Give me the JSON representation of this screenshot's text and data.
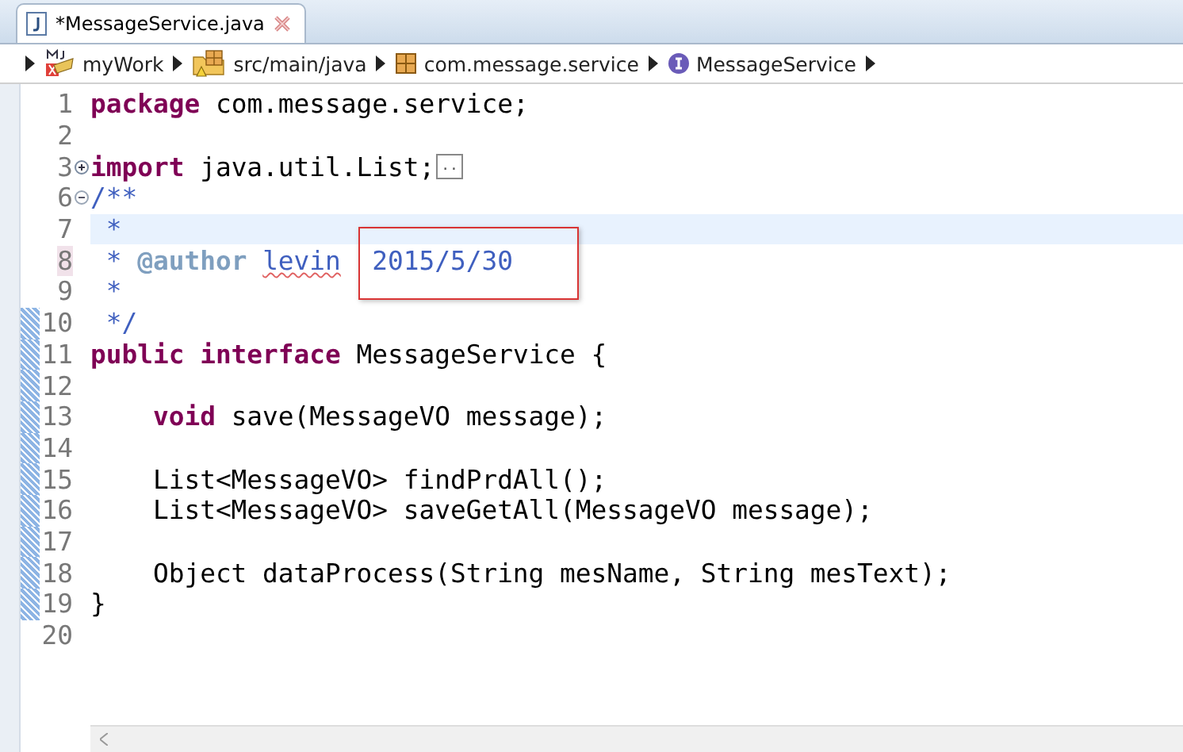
{
  "tab": {
    "title": "*MessageService.java",
    "selected": true
  },
  "breadcrumb": [
    {
      "kind": "project",
      "label": "myWork"
    },
    {
      "kind": "source-folder",
      "label": "src/main/java"
    },
    {
      "kind": "package",
      "label": "com.message.service"
    },
    {
      "kind": "interface",
      "label": "MessageService"
    }
  ],
  "lines": [
    {
      "number": "1",
      "changed": false,
      "current": false,
      "marked": false,
      "indented": false,
      "tokens": [
        {
          "kind": "keyword",
          "text": "package "
        },
        {
          "kind": "plain",
          "text": "com.message.service;"
        }
      ]
    },
    {
      "number": "2",
      "changed": false,
      "current": false,
      "marked": false
    },
    {
      "number": "3",
      "folded": true,
      "changed": false,
      "current": false,
      "marked": false,
      "indented": false,
      "tokens": [
        {
          "kind": "keyword",
          "text": "import "
        },
        {
          "kind": "plain",
          "text": "java.util.List;"
        },
        {
          "kind": "folded",
          "text": ".."
        }
      ]
    },
    {
      "number": "6",
      "folded": false,
      "changed": false,
      "current": false,
      "marked": false,
      "indented": false,
      "tokens": [
        {
          "kind": "comment",
          "text": "/**"
        }
      ]
    },
    {
      "number": "7",
      "changed": false,
      "current": true,
      "marked": false,
      "indented": false,
      "tokens": [
        {
          "kind": "comment",
          "text": " *"
        }
      ]
    },
    {
      "number": "8",
      "changed": false,
      "current": false,
      "marked": true,
      "indented": false,
      "tokens": [
        {
          "kind": "comment",
          "text": " * "
        },
        {
          "kind": "tag",
          "text": "@author "
        },
        {
          "kind": "misspelled",
          "text": "levin"
        },
        {
          "kind": "framed",
          "text": "  2015/5/30"
        }
      ]
    },
    {
      "number": "9",
      "changed": false,
      "current": false,
      "marked": false,
      "indented": false,
      "tokens": [
        {
          "kind": "comment",
          "text": " *"
        }
      ]
    },
    {
      "number": "10",
      "changed": true,
      "current": false,
      "marked": false,
      "indented": false,
      "tokens": [
        {
          "kind": "comment",
          "text": " */"
        }
      ]
    },
    {
      "number": "11",
      "changed": true,
      "current": false,
      "marked": false,
      "indented": false,
      "tokens": [
        {
          "kind": "keyword",
          "text": "public interface "
        },
        {
          "kind": "plain",
          "text": "MessageService {"
        }
      ]
    },
    {
      "number": "12",
      "changed": true,
      "current": false,
      "marked": false
    },
    {
      "number": "13",
      "changed": true,
      "current": false,
      "marked": false,
      "indented": true,
      "tokens": [
        {
          "kind": "keyword",
          "text": "void "
        },
        {
          "kind": "plain",
          "text": "save(MessageVO message);"
        }
      ]
    },
    {
      "number": "14",
      "changed": true,
      "current": false,
      "marked": false
    },
    {
      "number": "15",
      "changed": true,
      "current": false,
      "marked": false,
      "indented": true,
      "tokens": [
        {
          "kind": "plain",
          "text": "List<MessageVO> findPrdAll();"
        }
      ]
    },
    {
      "number": "16",
      "changed": true,
      "current": false,
      "marked": false,
      "indented": true,
      "tokens": [
        {
          "kind": "plain",
          "text": "List<MessageVO> saveGetAll(MessageVO message);"
        }
      ]
    },
    {
      "number": "17",
      "changed": true,
      "current": false,
      "marked": false
    },
    {
      "number": "18",
      "changed": true,
      "current": false,
      "marked": false,
      "indented": true,
      "tokens": [
        {
          "kind": "plain",
          "text": "Object dataProcess(String mesName, String mesText);"
        }
      ]
    },
    {
      "number": "19",
      "changed": true,
      "current": false,
      "marked": false,
      "indented": false,
      "tokens": [
        {
          "kind": "plain",
          "text": "}"
        }
      ]
    },
    {
      "number": "20",
      "changed": false,
      "current": false,
      "marked": false
    }
  ]
}
